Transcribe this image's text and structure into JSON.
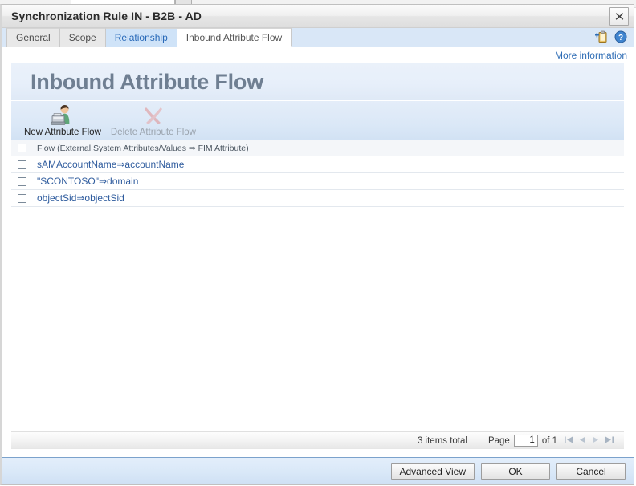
{
  "window": {
    "title": "Synchronization Rule IN - B2B - AD",
    "close_icon": "close-icon"
  },
  "tabs": [
    {
      "label": "General",
      "state": "normal"
    },
    {
      "label": "Scope",
      "state": "normal"
    },
    {
      "label": "Relationship",
      "state": "hover"
    },
    {
      "label": "Inbound Attribute Flow",
      "state": "active"
    }
  ],
  "tab_tools": {
    "new_icon": "clipboard-add-icon",
    "help_icon": "help-icon"
  },
  "more_information": {
    "label": "More information"
  },
  "page": {
    "header_title": "Inbound Attribute Flow"
  },
  "toolbar": {
    "new_label": "New Attribute Flow",
    "new_icon": "new-attribute-flow-icon",
    "delete_label": "Delete Attribute Flow",
    "delete_icon": "delete-x-icon",
    "delete_disabled": true
  },
  "table": {
    "header": "Flow (External System Attributes/Values ⇒ FIM Attribute)",
    "rows": [
      {
        "flow": "sAMAccountName⇒accountName",
        "checked": false
      },
      {
        "flow": "\"SCONTOSO\"⇒domain",
        "checked": false
      },
      {
        "flow": "objectSid⇒objectSid",
        "checked": false
      }
    ]
  },
  "pager": {
    "total_label": "3 items total",
    "page_label": "Page",
    "page_value": "1",
    "of_label": "of 1",
    "first_icon": "first-page-icon",
    "prev_icon": "previous-page-icon",
    "next_icon": "next-page-icon",
    "last_icon": "last-page-icon"
  },
  "footer": {
    "advanced_view_label": "Advanced View",
    "ok_label": "OK",
    "cancel_label": "Cancel"
  },
  "colors": {
    "accent_blue": "#2d6cb5",
    "link_blue": "#2f5c9e",
    "header_gray": "#6f7f92",
    "tab_strip": "#d9e7f7",
    "footer_blue": "#d9e8f8"
  }
}
